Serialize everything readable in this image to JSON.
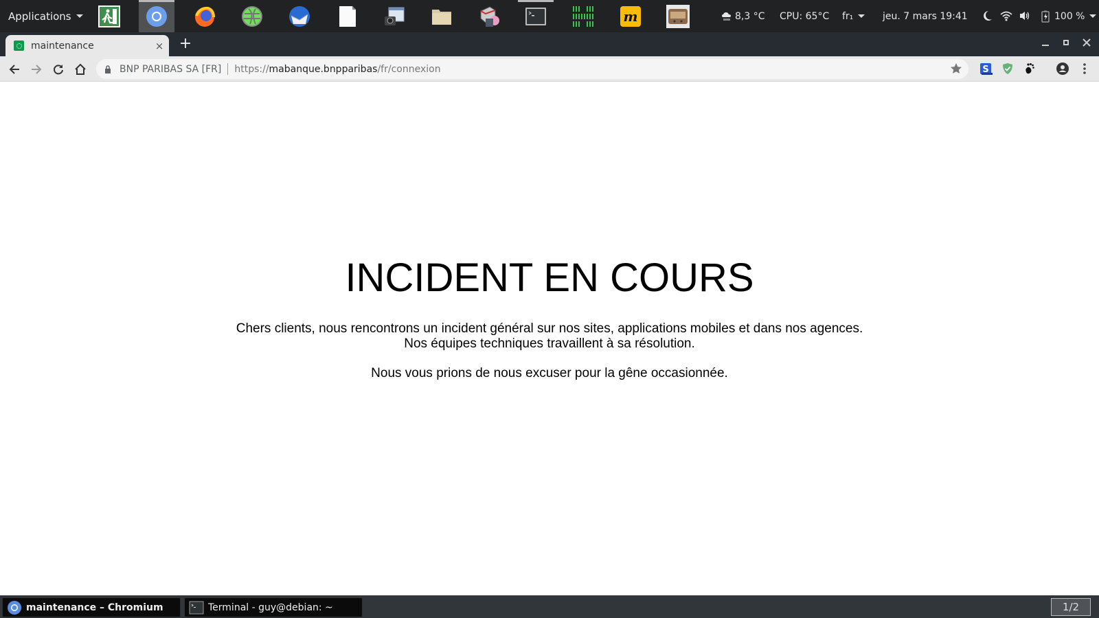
{
  "panel": {
    "applications_label": "Applications",
    "launchers": [
      {
        "name": "exit-launcher",
        "icon": "emergency-exit-icon"
      },
      {
        "name": "chromium-launcher",
        "icon": "chromium-icon",
        "active": true
      },
      {
        "name": "firefox-launcher",
        "icon": "firefox-icon"
      },
      {
        "name": "tor-browser-launcher",
        "icon": "globe-icon"
      },
      {
        "name": "thunderbird-launcher",
        "icon": "thunderbird-icon"
      },
      {
        "name": "libreoffice-launcher",
        "icon": "document-icon"
      },
      {
        "name": "screenshot-launcher",
        "icon": "screenshot-icon"
      },
      {
        "name": "file-manager-launcher",
        "icon": "folder-icon"
      },
      {
        "name": "disc-burner-launcher",
        "icon": "disc-burner-icon"
      },
      {
        "name": "terminal-launcher",
        "icon": "terminal-icon",
        "running": true
      },
      {
        "name": "system-monitor-launcher",
        "icon": "monitor-bars-icon"
      },
      {
        "name": "m-app-launcher",
        "icon": "m-app-icon"
      },
      {
        "name": "radio-launcher",
        "icon": "radio-icon"
      }
    ],
    "weather": "8,3 °C",
    "cpu": "CPU: 65°C",
    "keyboard_layout": "fr₁",
    "datetime": "jeu. 7 mars  19:41",
    "battery": "100 %"
  },
  "browser": {
    "tab_title": "maintenance",
    "tab_close": "×",
    "new_tab": "+",
    "window_controls": {
      "minimize": "–",
      "maximize": "▫",
      "close": "✕"
    },
    "omnibox": {
      "org": "BNP PARIBAS SA [FR]",
      "scheme": "https://",
      "host": "mabanque.bnpparibas",
      "path": "/fr/connexion"
    },
    "extensions": [
      "s-extension-icon",
      "adguard-shield-icon",
      "gnome-foot-icon"
    ]
  },
  "page": {
    "headline": "INCIDENT EN COURS",
    "line1": "Chers clients, nous rencontrons un incident général sur nos sites, applications mobiles et dans nos agences.",
    "line2": "Nos équipes techniques travaillent à sa résolution.",
    "line3": "Nous vous prions de nous excuser pour la gêne occasionnée."
  },
  "taskbar": {
    "tasks": [
      {
        "label": "maintenance – Chromium",
        "icon": "chromium-icon"
      },
      {
        "label": "Terminal - guy@debian: ~",
        "icon": "terminal-icon"
      }
    ],
    "workspace": "1/2"
  },
  "colors": {
    "panel_bg": "#212223",
    "tabstrip_bg": "#272c32",
    "toolbar_bg": "#e8e8e8",
    "bnp_green": "#0b9a4e",
    "taskbar_bg": "#31363b"
  }
}
